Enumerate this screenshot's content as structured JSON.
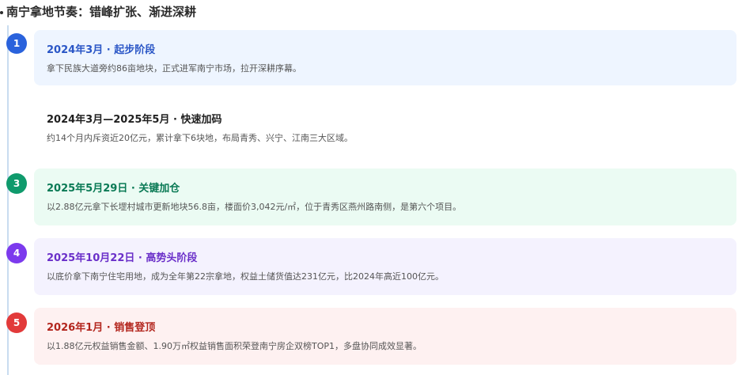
{
  "title": "南宁拿地节奏：错峰扩张、渐进深耕",
  "items": [
    {
      "number": "1",
      "title": "2024年3月 · 起步阶段",
      "description": "拿下民族大道旁约86亩地块，正式进军南宁市场，拉开深耕序幕。",
      "badge_color": "#2a62dc",
      "card_bg": "#eef5ff",
      "title_color": "#2a56c6"
    },
    {
      "number": "",
      "title": "2024年3月—2025年5月 · 快速加码",
      "description": "约14个月内斥资近20亿元，累计拿下6块地，布局青秀、兴宁、江南三大区域。",
      "badge_color": "",
      "card_bg": "#ffffff",
      "title_color": "#1f1f1f"
    },
    {
      "number": "3",
      "title": "2025年5月29日 · 关键加仓",
      "description": "以2.88亿元拿下长堽村城市更新地块56.8亩，楼面价3,042元/㎡，位于青秀区燕州路南侧，是第六个项目。",
      "badge_color": "#0f9a6c",
      "card_bg": "#ebfbf3",
      "title_color": "#0a7a55"
    },
    {
      "number": "4",
      "title": "2025年10月22日 · 高势头阶段",
      "description": "以底价拿下南宁住宅用地，成为全年第22宗拿地，权益土储货值达231亿元，比2024年高近100亿元。",
      "badge_color": "#7c3aed",
      "card_bg": "#f4f2fe",
      "title_color": "#6a2fc9"
    },
    {
      "number": "5",
      "title": "2026年1月 · 销售登顶",
      "description": "以1.88亿元权益销售金额、1.90万㎡权益销售面积荣登南宁房企双榜TOP1，多盘协同成效显著。",
      "badge_color": "#e23a3a",
      "card_bg": "#fef1f1",
      "title_color": "#b3261e"
    }
  ]
}
